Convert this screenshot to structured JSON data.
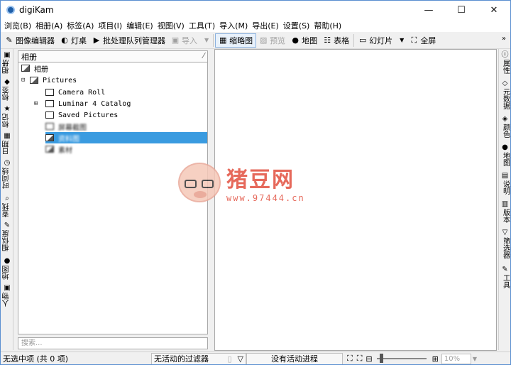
{
  "window": {
    "title": "digiKam",
    "minimize": "—",
    "maximize": "☐",
    "close": "✕"
  },
  "menu": [
    "浏览(B)",
    "相册(A)",
    "标签(A)",
    "项目(I)",
    "编辑(E)",
    "视图(V)",
    "工具(T)",
    "导入(M)",
    "导出(E)",
    "设置(S)",
    "帮助(H)"
  ],
  "toolbar": {
    "image_editor": "图像编辑器",
    "light_table": "灯桌",
    "batch_queue": "批处理队列管理器",
    "import": "导入",
    "thumbnails": "缩略图",
    "preview": "预览",
    "map": "地图",
    "table": "表格",
    "slideshow": "幻灯片",
    "fullscreen": "全屏"
  },
  "left_tabs": [
    "相册",
    "标签",
    "标记",
    "日期",
    "时间线",
    "查找",
    "相似度",
    "地图",
    "人物"
  ],
  "right_tabs": [
    "属性",
    "元数据",
    "颜色",
    "地图",
    "说明",
    "版本",
    "筛选器",
    "工具"
  ],
  "album_panel": {
    "header": "相册",
    "root": "相册",
    "collection": "Pictures",
    "items": [
      "Camera Roll",
      "Luminar 4 Catalog",
      "Saved Pictures",
      "屏幕截图",
      "资料图",
      "素材"
    ],
    "search_placeholder": "搜索..."
  },
  "watermark": {
    "name": "猪豆网",
    "url": "www.97444.cn"
  },
  "status": {
    "selection": "无选中项 (共 0 项)",
    "filter": "无活动的过滤器",
    "progress": "没有活动进程",
    "zoom": "10%"
  }
}
